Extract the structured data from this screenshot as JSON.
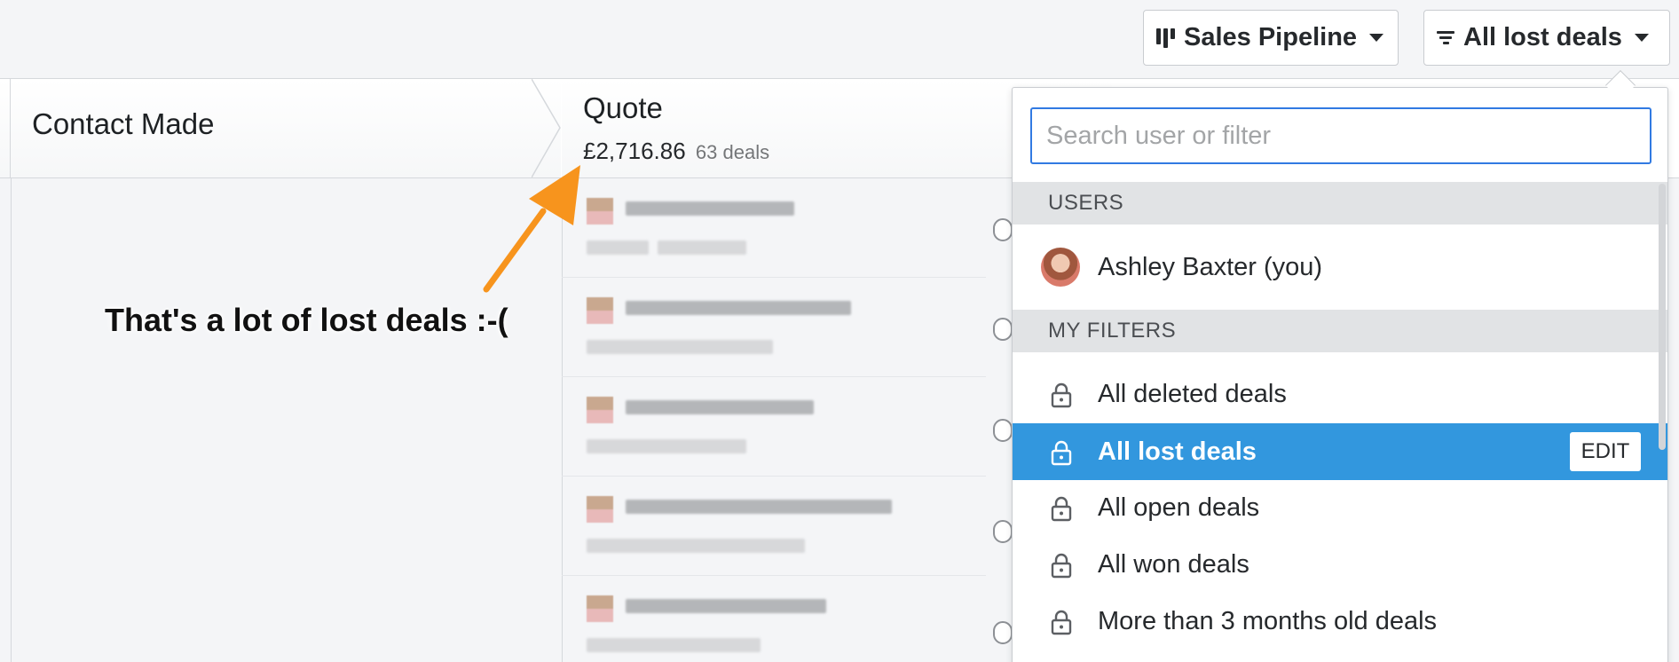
{
  "toolbar": {
    "pipeline_label": "Sales Pipeline",
    "filter_label": "All lost deals"
  },
  "stages": [
    {
      "title": "Contact Made"
    },
    {
      "title": "Quote",
      "sum": "£2,716.86",
      "count": "63 deals"
    }
  ],
  "annotation": {
    "text": "That's a lot of lost deals :-("
  },
  "dropdown": {
    "search_placeholder": "Search user or filter",
    "users_header": "USERS",
    "users": [
      {
        "label": "Ashley Baxter (you)"
      }
    ],
    "filters_header": "MY FILTERS",
    "filters": [
      {
        "label": "All deleted deals"
      },
      {
        "label": "All lost deals",
        "selected": true,
        "edit_label": "EDIT"
      },
      {
        "label": "All open deals"
      },
      {
        "label": "All won deals"
      },
      {
        "label": "More than 3 months old deals"
      }
    ]
  },
  "colors": {
    "accent": "#317ae2",
    "selected_row": "#3297de",
    "annotation_arrow": "#f7941d"
  },
  "icons": {
    "pipeline": "pipeline-icon",
    "filter": "filter-icon",
    "lock": "lock-icon",
    "caret": "caret-down-icon"
  }
}
